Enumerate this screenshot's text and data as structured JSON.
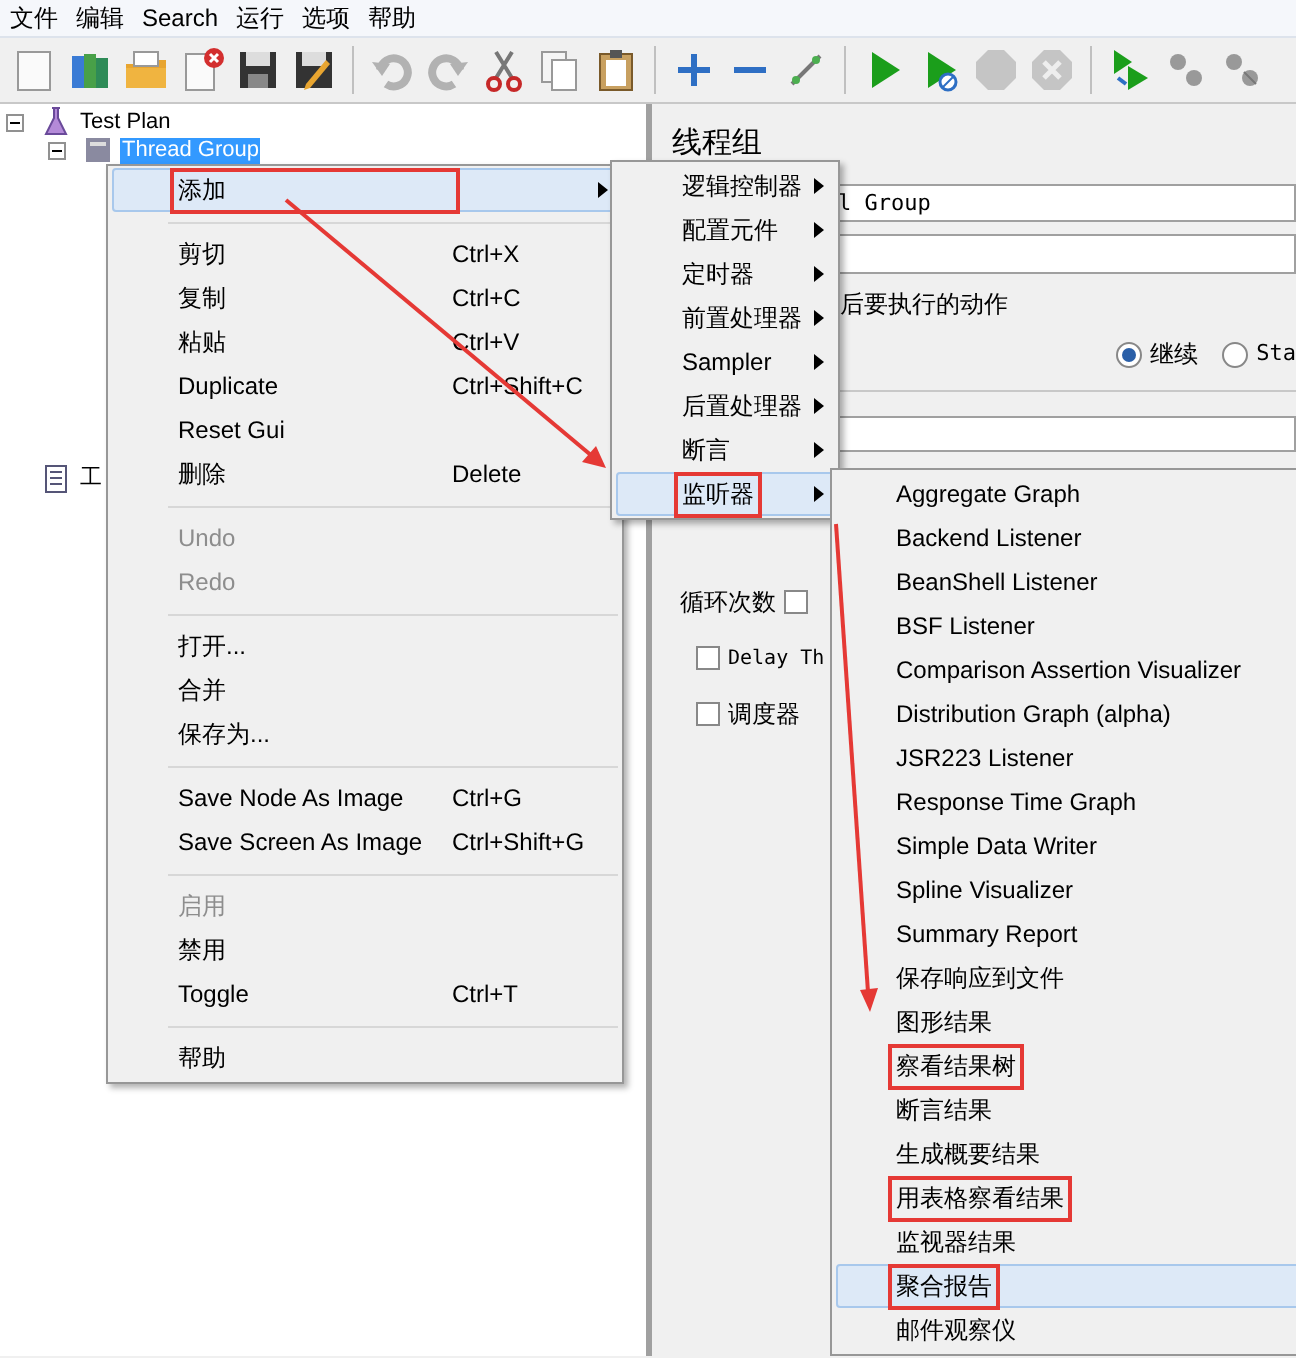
{
  "menubar": [
    "文件",
    "编辑",
    "Search",
    "运行",
    "选项",
    "帮助"
  ],
  "toolbar": [
    {
      "kind": "new"
    },
    {
      "kind": "templates"
    },
    {
      "kind": "open"
    },
    {
      "kind": "close"
    },
    {
      "kind": "save"
    },
    {
      "kind": "save-as"
    },
    {
      "kind": "sep"
    },
    {
      "kind": "undo"
    },
    {
      "kind": "redo"
    },
    {
      "kind": "cut"
    },
    {
      "kind": "copy"
    },
    {
      "kind": "paste"
    },
    {
      "kind": "sep"
    },
    {
      "kind": "expand"
    },
    {
      "kind": "collapse"
    },
    {
      "kind": "toggle"
    },
    {
      "kind": "sep"
    },
    {
      "kind": "start"
    },
    {
      "kind": "start-no-pause"
    },
    {
      "kind": "stop"
    },
    {
      "kind": "shutdown"
    },
    {
      "kind": "sep"
    },
    {
      "kind": "remote-start"
    },
    {
      "kind": "remote-stop"
    },
    {
      "kind": "remote-shutdown"
    }
  ],
  "tree": [
    {
      "label": "Test Plan",
      "expanded": true,
      "selected": false,
      "kind": "plan",
      "children": [
        {
          "label": "Thread Group",
          "expanded": true,
          "selected": true,
          "kind": "group"
        }
      ]
    },
    {
      "label": "工",
      "selected": false,
      "kind": "workbench"
    }
  ],
  "panel": {
    "title": "线程组",
    "name_value": "l Group",
    "action_label": "后要执行的动作",
    "radios": [
      {
        "label": "继续",
        "selected": true
      },
      {
        "label": "Sta",
        "selected": false
      }
    ],
    "loop_label": "循环次数",
    "loop_checked": false,
    "checkboxes": [
      {
        "label": "Delay Th",
        "checked": false
      },
      {
        "label": "调度器",
        "checked": false
      }
    ]
  },
  "context_menu": [
    {
      "kind": "item",
      "label": "添加",
      "submenu": true,
      "selected": true,
      "annotated": true
    },
    {
      "kind": "separator"
    },
    {
      "kind": "item",
      "label": "剪切",
      "shortcut": "Ctrl+X"
    },
    {
      "kind": "item",
      "label": "复制",
      "shortcut": "Ctrl+C"
    },
    {
      "kind": "item",
      "label": "粘贴",
      "shortcut": "Ctrl+V"
    },
    {
      "kind": "item",
      "label": "Duplicate",
      "shortcut": "Ctrl+Shift+C"
    },
    {
      "kind": "item",
      "label": "Reset Gui"
    },
    {
      "kind": "item",
      "label": "删除",
      "shortcut": "Delete"
    },
    {
      "kind": "separator"
    },
    {
      "kind": "item",
      "label": "Undo",
      "disabled": true
    },
    {
      "kind": "item",
      "label": "Redo",
      "disabled": true
    },
    {
      "kind": "separator"
    },
    {
      "kind": "item",
      "label": "打开..."
    },
    {
      "kind": "item",
      "label": "合并"
    },
    {
      "kind": "item",
      "label": "保存为..."
    },
    {
      "kind": "separator"
    },
    {
      "kind": "item",
      "label": "Save Node As Image",
      "shortcut": "Ctrl+G"
    },
    {
      "kind": "item",
      "label": "Save Screen As Image",
      "shortcut": "Ctrl+Shift+G"
    },
    {
      "kind": "separator"
    },
    {
      "kind": "item",
      "label": "启用",
      "disabled": true
    },
    {
      "kind": "item",
      "label": "禁用"
    },
    {
      "kind": "item",
      "label": "Toggle",
      "shortcut": "Ctrl+T"
    },
    {
      "kind": "separator"
    },
    {
      "kind": "item",
      "label": "帮助"
    }
  ],
  "add_submenu": [
    {
      "label": "逻辑控制器",
      "selected": false
    },
    {
      "label": "配置元件",
      "selected": false
    },
    {
      "label": "定时器",
      "selected": false
    },
    {
      "label": "前置处理器",
      "selected": false
    },
    {
      "label": "Sampler",
      "selected": false
    },
    {
      "label": "后置处理器",
      "selected": false
    },
    {
      "label": "断言",
      "selected": false
    },
    {
      "label": "监听器",
      "selected": true,
      "annotated": true
    }
  ],
  "listener_submenu": [
    {
      "label": "Aggregate Graph",
      "selected": false
    },
    {
      "label": "Backend Listener",
      "selected": false
    },
    {
      "label": "BeanShell Listener",
      "selected": false
    },
    {
      "label": "BSF Listener",
      "selected": false
    },
    {
      "label": "Comparison Assertion Visualizer",
      "selected": false
    },
    {
      "label": "Distribution Graph (alpha)",
      "selected": false
    },
    {
      "label": "JSR223 Listener",
      "selected": false
    },
    {
      "label": "Response Time Graph",
      "selected": false
    },
    {
      "label": "Simple Data Writer",
      "selected": false
    },
    {
      "label": "Spline Visualizer",
      "selected": false
    },
    {
      "label": "Summary Report",
      "selected": false
    },
    {
      "label": "保存响应到文件",
      "selected": false
    },
    {
      "label": "图形结果",
      "selected": false
    },
    {
      "label": "察看结果树",
      "selected": false,
      "annotated": true
    },
    {
      "label": "断言结果",
      "selected": false
    },
    {
      "label": "生成概要结果",
      "selected": false
    },
    {
      "label": "用表格察看结果",
      "selected": false,
      "annotated": true
    },
    {
      "label": "监视器结果",
      "selected": false
    },
    {
      "label": "聚合报告",
      "selected": true,
      "annotated": true
    },
    {
      "label": "邮件观察仪",
      "selected": false
    }
  ]
}
